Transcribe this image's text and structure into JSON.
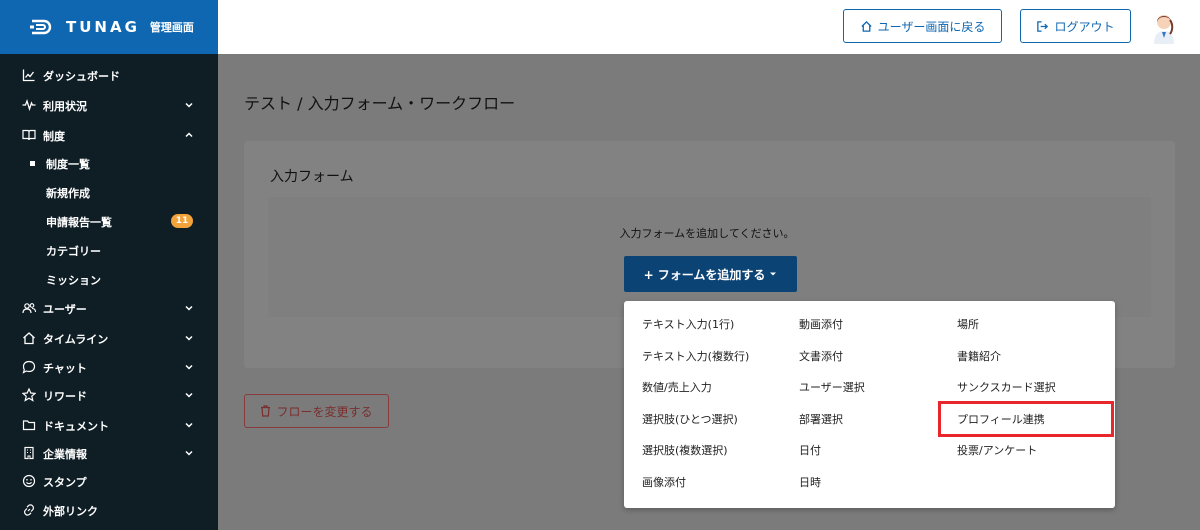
{
  "header": {
    "brand": "TUNAG",
    "brand_sub": "管理画面",
    "user_screen_label": "ユーザー画面に戻る",
    "logout_label": "ログアウト"
  },
  "sidebar": {
    "items": [
      {
        "label": "ダッシュボード",
        "icon": "chart-icon"
      },
      {
        "label": "利用状況",
        "icon": "pulse-icon"
      },
      {
        "label": "制度",
        "icon": "book-icon"
      },
      {
        "label": "制度一覧"
      },
      {
        "label": "新規作成"
      },
      {
        "label": "申請報告一覧",
        "badge": "11"
      },
      {
        "label": "カテゴリー"
      },
      {
        "label": "ミッション"
      },
      {
        "label": "ユーザー",
        "icon": "users-icon"
      },
      {
        "label": "タイムライン",
        "icon": "home-icon"
      },
      {
        "label": "チャット",
        "icon": "chat-icon"
      },
      {
        "label": "リワード",
        "icon": "star-icon"
      },
      {
        "label": "ドキュメント",
        "icon": "folder-icon"
      },
      {
        "label": "企業情報",
        "icon": "building-icon"
      },
      {
        "label": "スタンプ",
        "icon": "smile-icon"
      },
      {
        "label": "外部リンク",
        "icon": "link-icon"
      }
    ]
  },
  "main": {
    "title": "テスト / 入力フォーム・ワークフロー",
    "card_title": "入力フォーム",
    "empty_text": "入力フォームを追加してください。",
    "add_button": "+ フォームを追加する",
    "flow_button": "フローを変更する"
  },
  "dropdown": {
    "col1": [
      "テキスト入力(1行)",
      "テキスト入力(複数行)",
      "数値/売上入力",
      "選択肢(ひとつ選択)",
      "選択肢(複数選択)",
      "画像添付"
    ],
    "col2": [
      "動画添付",
      "文書添付",
      "ユーザー選択",
      "部署選択",
      "日付",
      "日時"
    ],
    "col3": [
      "場所",
      "書籍紹介",
      "サンクスカード選択",
      "プロフィール連携",
      "投票/アンケート"
    ]
  },
  "colors": {
    "brand": "#0f67b1",
    "sidebar": "#0f1d25",
    "badge": "#f2a33a",
    "highlight": "#e8262b"
  }
}
